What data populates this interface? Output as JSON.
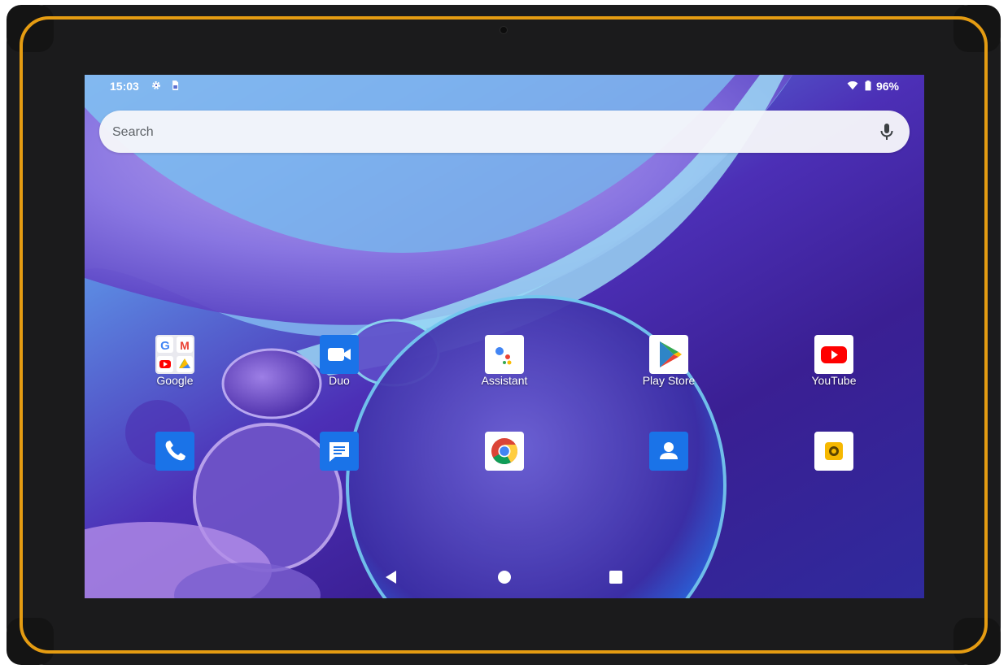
{
  "status": {
    "time": "15:03",
    "battery": "96%",
    "icons": [
      "settings-icon",
      "sim-icon",
      "wifi-icon",
      "battery-icon"
    ]
  },
  "search": {
    "placeholder": "Search",
    "mic_icon": "mic-icon"
  },
  "apps_row1": [
    {
      "label": "Google",
      "icon": "google-folder-icon"
    },
    {
      "label": "Duo",
      "icon": "duo-icon"
    },
    {
      "label": "Assistant",
      "icon": "assistant-icon"
    },
    {
      "label": "Play Store",
      "icon": "play-store-icon"
    },
    {
      "label": "YouTube",
      "icon": "youtube-icon"
    }
  ],
  "dock": [
    {
      "icon": "phone-icon"
    },
    {
      "icon": "messages-icon"
    },
    {
      "icon": "chrome-icon"
    },
    {
      "icon": "contacts-icon"
    },
    {
      "icon": "camera-icon"
    }
  ],
  "nav": [
    "back-icon",
    "home-icon",
    "recents-icon"
  ],
  "colors": {
    "frame": "#1b1b1c",
    "accent_trim": "#e59c12",
    "wallpaper_dark": "#3a1f93",
    "wallpaper_light": "#7fb7ef"
  }
}
